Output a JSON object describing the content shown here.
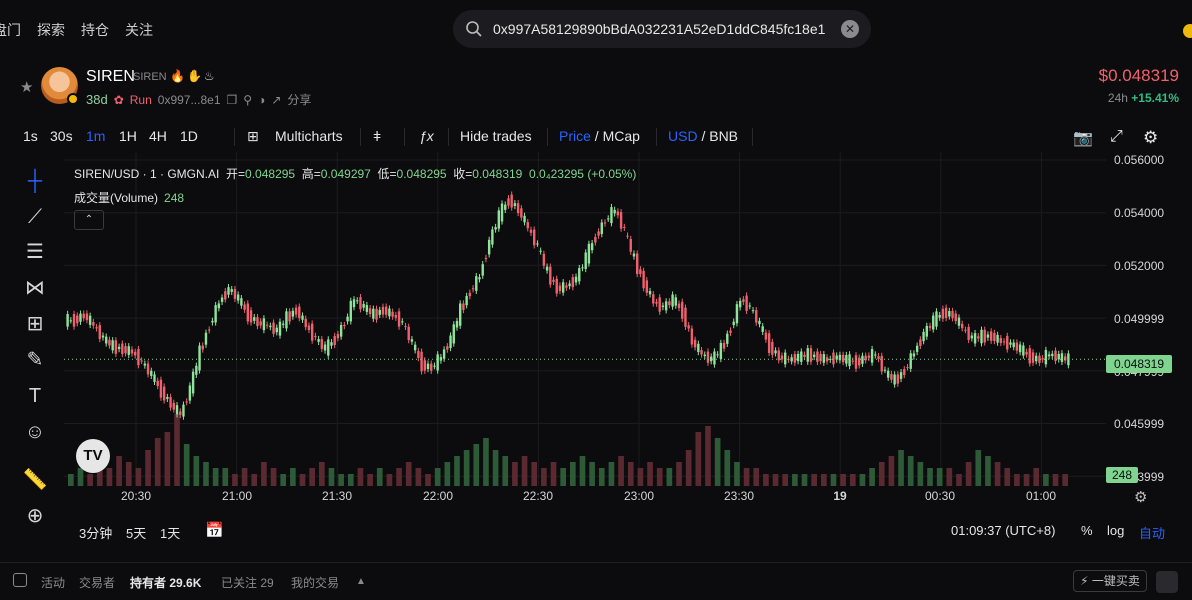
{
  "nav": {
    "items": [
      "盘门",
      "探索",
      "持仓",
      "关注"
    ]
  },
  "search": {
    "value": "0x997A58129890bBdA032231A52eD1ddC845fc18e1"
  },
  "token": {
    "name": "SIREN",
    "symbol": "SIREN",
    "age": "38d",
    "run_label": "Run",
    "address_short": "0x997...8e1",
    "share_label": "分享",
    "price": "$0.048319",
    "change_period": "24h",
    "change_value": "+15.41%"
  },
  "toolbar": {
    "timeframes": [
      "1s",
      "30s",
      "1m",
      "1H",
      "4H",
      "1D"
    ],
    "active_timeframe": "1m",
    "multicharts": "Multicharts",
    "hide_trades": "Hide trades",
    "price_label": "Price",
    "mcap_label": "MCap",
    "usd_label": "USD",
    "bnb_label": "BNB",
    "slash": "/"
  },
  "legend": {
    "title": "SIREN/USD · 1 · GMGN.AI",
    "open_label": "开=",
    "open": "0.048295",
    "high_label": "高=",
    "high": "0.049297",
    "low_label": "低=",
    "low": "0.048295",
    "close_label": "收=",
    "close": "0.048319",
    "diff": "0.0₄23295 (+0.05%)",
    "volume_label": "成交量(Volume)",
    "volume": "248"
  },
  "price_axis": {
    "labels": [
      "0.056000",
      "0.054000",
      "0.052000",
      "0.049999",
      "0.047999",
      "0.045999",
      "0.043999"
    ],
    "current_tag": "0.048319",
    "volume_tag": "248"
  },
  "time_axis": {
    "labels": [
      "20:30",
      "21:00",
      "21:30",
      "22:00",
      "22:30",
      "23:00",
      "23:30",
      "19",
      "00:30",
      "01:00"
    ]
  },
  "bottom": {
    "ranges": [
      "3分钟",
      "5天",
      "1天"
    ],
    "clock": "01:09:37 (UTC+8)",
    "percent": "%",
    "log": "log",
    "auto": "自动"
  },
  "footer": {
    "activity": "活动",
    "traders": "交易者",
    "holders_label": "持有者",
    "holders_count": "29.6K",
    "following": "已关注 29",
    "my_trades": "我的交易",
    "quick_buy": "一键买卖"
  },
  "chart_data": {
    "type": "candlestick",
    "pair": "SIREN/USD",
    "interval": "1",
    "source": "GMGN.AI",
    "ylim": [
      0.0435,
      0.0562
    ],
    "x_labels": [
      "20:30",
      "21:00",
      "21:30",
      "22:00",
      "22:30",
      "23:00",
      "23:30",
      "19",
      "00:30",
      "01:00"
    ],
    "close_series": [
      0.0498,
      0.05,
      0.0496,
      0.0491,
      0.0488,
      0.0487,
      0.0486,
      0.0482,
      0.0477,
      0.0471,
      0.0466,
      0.0462,
      0.0472,
      0.0486,
      0.0496,
      0.0505,
      0.051,
      0.0506,
      0.05,
      0.0497,
      0.0496,
      0.0494,
      0.0499,
      0.0502,
      0.0496,
      0.0491,
      0.0487,
      0.0491,
      0.0497,
      0.0506,
      0.0503,
      0.05,
      0.0502,
      0.05,
      0.0497,
      0.0489,
      0.0481,
      0.048,
      0.0484,
      0.0491,
      0.0502,
      0.0509,
      0.0515,
      0.0528,
      0.0538,
      0.0544,
      0.054,
      0.0533,
      0.0526,
      0.0516,
      0.051,
      0.0511,
      0.0514,
      0.0522,
      0.053,
      0.0536,
      0.054,
      0.0532,
      0.0521,
      0.0512,
      0.0505,
      0.0503,
      0.0506,
      0.0501,
      0.049,
      0.0485,
      0.0483,
      0.0487,
      0.0495,
      0.0506,
      0.0503,
      0.0496,
      0.0488,
      0.0484,
      0.0483,
      0.0484,
      0.0485,
      0.0484,
      0.0483,
      0.0484,
      0.0483,
      0.0482,
      0.0484,
      0.0485,
      0.0478,
      0.0475,
      0.0479,
      0.0486,
      0.0493,
      0.0498,
      0.0501,
      0.05,
      0.0495,
      0.0491,
      0.0492,
      0.0492,
      0.049,
      0.0489,
      0.0487,
      0.0484,
      0.0483,
      0.0485,
      0.0484,
      0.0483
    ],
    "volume_series": [
      2,
      3,
      2,
      4,
      3,
      5,
      4,
      3,
      6,
      8,
      9,
      12,
      7,
      5,
      4,
      3,
      3,
      2,
      3,
      2,
      4,
      3,
      2,
      3,
      2,
      3,
      4,
      3,
      2,
      2,
      3,
      2,
      3,
      2,
      3,
      4,
      3,
      2,
      3,
      4,
      5,
      6,
      7,
      8,
      6,
      5,
      4,
      5,
      4,
      3,
      4,
      3,
      4,
      5,
      4,
      3,
      4,
      5,
      4,
      3,
      4,
      3,
      3,
      4,
      6,
      9,
      10,
      8,
      6,
      4,
      3,
      3,
      2,
      2,
      2,
      2,
      2,
      2,
      2,
      2,
      2,
      2,
      2,
      3,
      4,
      5,
      6,
      5,
      4,
      3,
      3,
      3,
      2,
      4,
      6,
      5,
      4,
      3,
      2,
      2,
      3,
      2,
      2,
      2
    ],
    "last_volume": 248
  }
}
